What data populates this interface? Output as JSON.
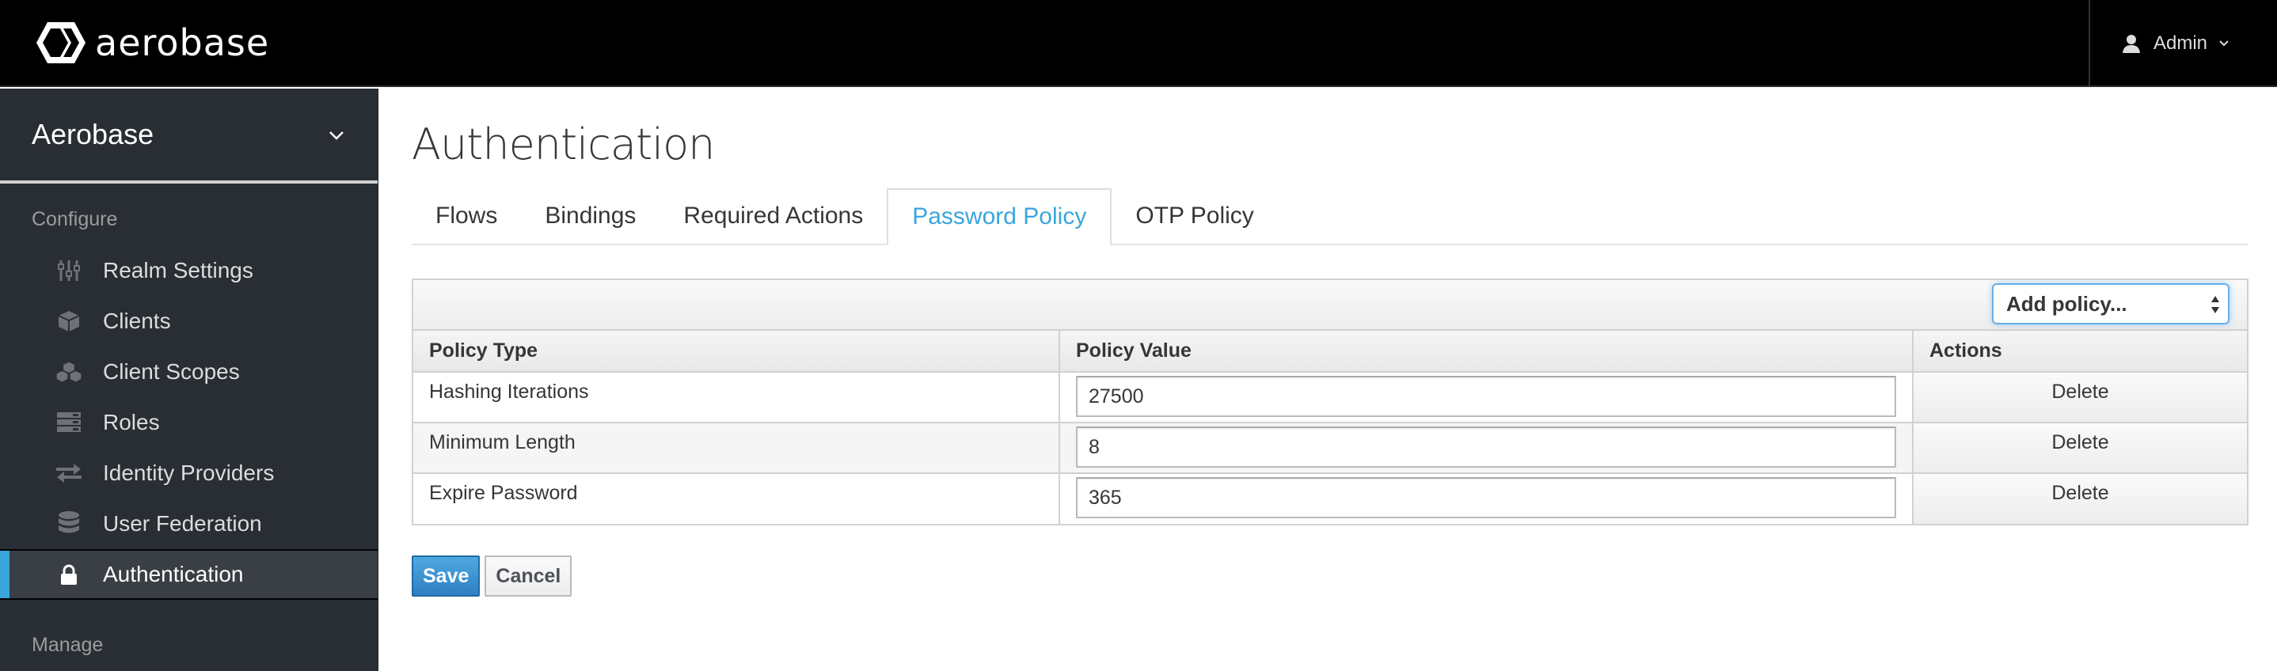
{
  "header": {
    "brand": "aerobase",
    "user": {
      "name": "Admin",
      "icon": "user-icon"
    }
  },
  "sidebar": {
    "realm": "Aerobase",
    "configure_label": "Configure",
    "manage_label": "Manage",
    "items": [
      {
        "label": "Realm Settings",
        "icon": "sliders-icon"
      },
      {
        "label": "Clients",
        "icon": "cube-icon"
      },
      {
        "label": "Client Scopes",
        "icon": "cubes-icon"
      },
      {
        "label": "Roles",
        "icon": "server-icon"
      },
      {
        "label": "Identity Providers",
        "icon": "exchange-icon"
      },
      {
        "label": "User Federation",
        "icon": "database-icon"
      },
      {
        "label": "Authentication",
        "icon": "lock-icon",
        "active": true
      }
    ]
  },
  "main": {
    "title": "Authentication",
    "tabs": [
      {
        "label": "Flows"
      },
      {
        "label": "Bindings"
      },
      {
        "label": "Required Actions"
      },
      {
        "label": "Password Policy",
        "active": true
      },
      {
        "label": "OTP Policy"
      }
    ],
    "add_policy_select": "Add policy...",
    "table": {
      "headers": [
        "Policy Type",
        "Policy Value",
        "Actions"
      ],
      "rows": [
        {
          "type": "Hashing Iterations",
          "value": "27500",
          "action": "Delete"
        },
        {
          "type": "Minimum Length",
          "value": "8",
          "action": "Delete"
        },
        {
          "type": "Expire Password",
          "value": "365",
          "action": "Delete"
        }
      ]
    },
    "save_label": "Save",
    "cancel_label": "Cancel"
  },
  "colors": {
    "accent": "#39a5dc",
    "sidebar_bg": "#292e34",
    "header_bg": "#000000"
  }
}
